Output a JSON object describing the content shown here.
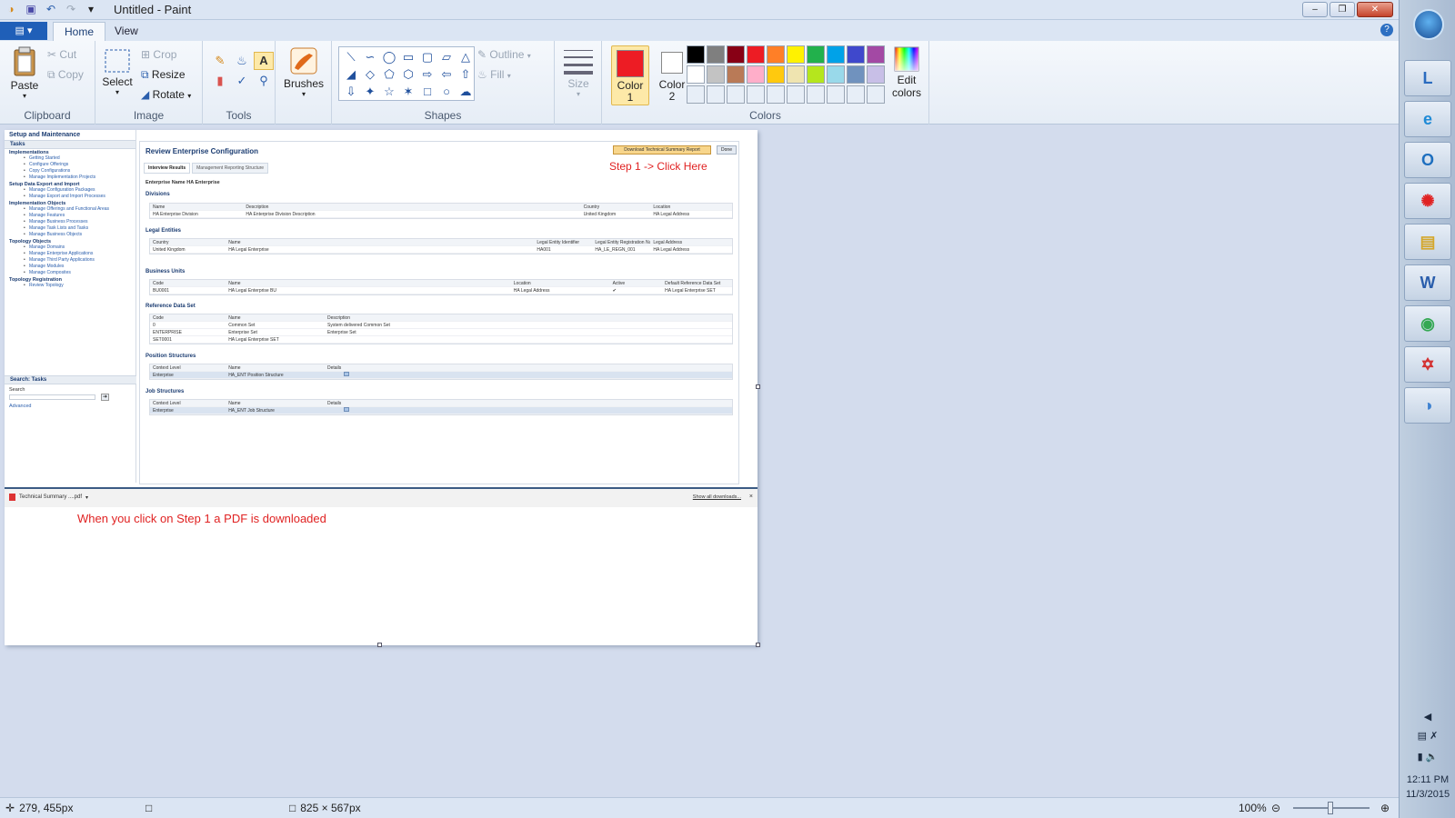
{
  "window": {
    "title": "Untitled - Paint",
    "minimize": "–",
    "restore": "❐",
    "close": "✕"
  },
  "tabs": {
    "home": "Home",
    "view": "View"
  },
  "ribbon": {
    "clipboard": {
      "label": "Clipboard",
      "paste": "Paste",
      "cut": "Cut",
      "copy": "Copy"
    },
    "image": {
      "label": "Image",
      "select": "Select",
      "crop": "Crop",
      "resize": "Resize",
      "rotate": "Rotate"
    },
    "tools": {
      "label": "Tools"
    },
    "brushes": {
      "label": "Brushes"
    },
    "shapes": {
      "label": "Shapes",
      "outline": "Outline",
      "fill": "Fill"
    },
    "size": {
      "label": "Size"
    },
    "colors": {
      "label": "Colors",
      "color1_line1": "Color",
      "color1_line2": "1",
      "color2_line1": "Color",
      "color2_line2": "2",
      "edit_line1": "Edit",
      "edit_line2": "colors",
      "color1": "#ed1c24",
      "color2": "#ffffff",
      "palette": [
        "#000000",
        "#7f7f7f",
        "#880015",
        "#ed1c24",
        "#ff7f27",
        "#fff200",
        "#22b14c",
        "#00a2e8",
        "#3f48cc",
        "#a349a4",
        "#ffffff",
        "#c3c3c3",
        "#b97a57",
        "#ffaec9",
        "#ffc90e",
        "#efe4b0",
        "#b5e61d",
        "#99d9ea",
        "#7092be",
        "#c8bfe7",
        "#e7eef7",
        "#e7eef7",
        "#e7eef7",
        "#e7eef7",
        "#e7eef7",
        "#e7eef7",
        "#e7eef7",
        "#e7eef7",
        "#e7eef7",
        "#e7eef7"
      ]
    }
  },
  "app": {
    "panel_title": "Setup and Maintenance",
    "tasks_header": "Tasks",
    "sections": [
      {
        "title": "Implementations",
        "items": [
          "Getting Started",
          "Configure Offerings",
          "Copy Configurations",
          "Manage Implementation Projects"
        ]
      },
      {
        "title": "Setup Data Export and Import",
        "items": [
          "Manage Configuration Packages",
          "Manage Export and Import Processes"
        ]
      },
      {
        "title": "Implementation Objects",
        "items": [
          "Manage Offerings and Functional Areas",
          "Manage Features",
          "Manage Business Processes",
          "Manage Task Lists and Tasks",
          "Manage Business Objects"
        ]
      },
      {
        "title": "Topology Objects",
        "items": [
          "Manage Domains",
          "Manage Enterprise Applications",
          "Manage Third Party Applications",
          "Manage Modules",
          "Manage Composites"
        ]
      },
      {
        "title": "Topology Registration",
        "items": [
          "Review Topology"
        ]
      }
    ],
    "search_header": "Search: Tasks",
    "search_label": "Search",
    "advanced": "Advanced",
    "main_title": "Review Enterprise Configuration",
    "download_btn": "Download Technical Summary Report",
    "done_btn": "Done",
    "step1": "Step 1 -> Click Here",
    "subtab1": "Interview Results",
    "subtab2": "Management Reporting Structure",
    "enterprise_name": "Enterprise Name  HA Enterprise",
    "divisions": {
      "title": "Divisions",
      "headers": [
        "Name",
        "Description",
        "Country",
        "Location"
      ],
      "rows": [
        [
          "HA Enterprise Division",
          "HA Enterprise Division Description",
          "United Kingdom",
          "HA Legal Address"
        ]
      ]
    },
    "legal": {
      "title": "Legal Entities",
      "headers": [
        "Country",
        "Name",
        "Legal Entity Identifier",
        "Legal Entity Registration Number",
        "Legal Address"
      ],
      "rows": [
        [
          "United Kingdom",
          "HA Legal Enterprise",
          "HA001",
          "HA_LE_REGN_001",
          "HA Legal Address"
        ]
      ]
    },
    "bu": {
      "title": "Business Units",
      "headers": [
        "Code",
        "Name",
        "Location",
        "Active",
        "Default Reference Data Set"
      ],
      "rows": [
        [
          "BU0001",
          "HA Legal Enterprise BU",
          "HA Legal Address",
          "✔",
          "HA Legal Enterprise SET"
        ]
      ]
    },
    "refdata": {
      "title": "Reference Data Set",
      "headers": [
        "Code",
        "Name",
        "Description"
      ],
      "rows": [
        [
          "0",
          "Common Set",
          "System delivered Common Set"
        ],
        [
          "ENTERPRISE",
          "Enterprise Set",
          "Enterprise Set"
        ],
        [
          "SET0001",
          "HA Legal Enterprise SET",
          ""
        ]
      ]
    },
    "position": {
      "title": "Position Structures",
      "headers": [
        "Context Level",
        "Name",
        "Details"
      ],
      "rows": [
        [
          "Enterprise",
          "HA_ENT Position Structure",
          ""
        ]
      ]
    },
    "job": {
      "title": "Job Structures",
      "headers": [
        "Context Level",
        "Name",
        "Details"
      ],
      "rows": [
        [
          "Enterprise",
          "HA_ENT Job Structure",
          ""
        ]
      ]
    },
    "download_file": "Technical Summary ....pdf",
    "show_all": "Show all downloads...",
    "note": "When you click on Step 1 a PDF is downloaded"
  },
  "taskbar": {
    "time": "12:11 PM",
    "date": "11/3/2015",
    "apps": [
      "lync-icon",
      "ie-icon",
      "outlook-icon",
      "airtel-icon",
      "explorer-icon",
      "word-icon",
      "chrome-icon",
      "acrobat-icon",
      "paint-icon"
    ]
  },
  "status": {
    "cursor": "279, 455px",
    "image_size": "825 × 567px",
    "zoom": "100%"
  }
}
